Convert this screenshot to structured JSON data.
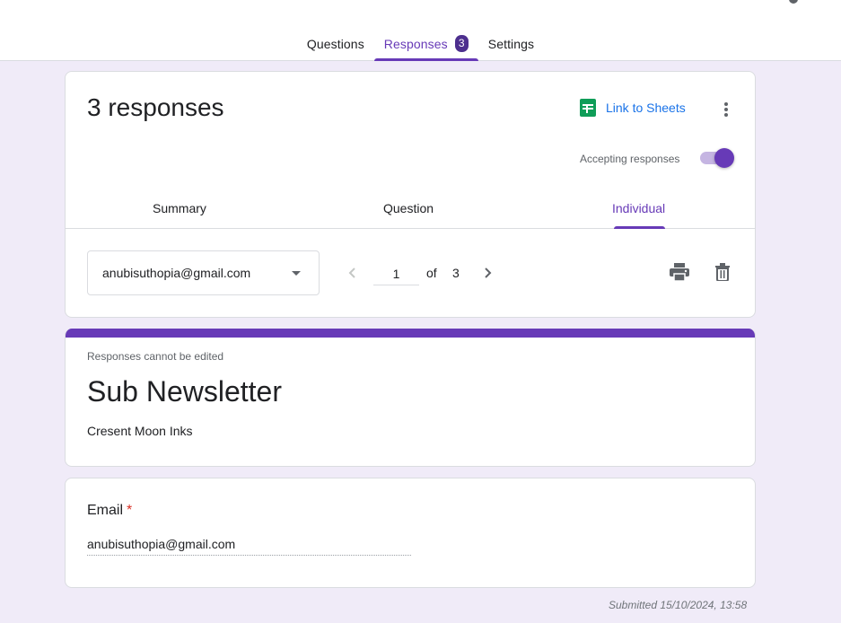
{
  "tabs": [
    {
      "label": "Questions"
    },
    {
      "label": "Responses",
      "badge": "3"
    },
    {
      "label": "Settings"
    }
  ],
  "summary": {
    "title": "3 responses",
    "link_label": "Link to Sheets",
    "accepting_label": "Accepting responses",
    "accepting": true,
    "subtabs": [
      {
        "label": "Summary"
      },
      {
        "label": "Question"
      },
      {
        "label": "Individual"
      }
    ],
    "active_subtab": "Individual"
  },
  "individual": {
    "respondent": "anubisuthopia@gmail.com",
    "page": "1",
    "of": "of",
    "total": "3"
  },
  "form": {
    "notice": "Responses cannot be edited",
    "title": "Sub Newsletter",
    "description": "Cresent Moon Inks"
  },
  "question": {
    "label": "Email",
    "required_mark": "*",
    "answer": "anubisuthopia@gmail.com"
  },
  "submitted": "Submitted 15/10/2024, 13:58",
  "colors": {
    "accent": "#673ab7",
    "link": "#1a73e8",
    "background": "#f0ebf8",
    "sheets": "#0f9d58",
    "required": "#d93025"
  },
  "icons": [
    "sheets-icon",
    "more-vert-icon",
    "chevron-left-icon",
    "chevron-right-icon",
    "print-icon",
    "delete-icon",
    "dropdown-arrow-icon"
  ]
}
